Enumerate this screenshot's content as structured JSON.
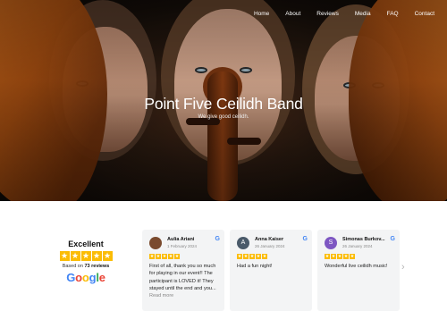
{
  "nav": {
    "items": [
      "Home",
      "About",
      "Reviews",
      "Media",
      "FAQ",
      "Contact"
    ]
  },
  "hero": {
    "title": "Point Five Ceilidh Band",
    "subtitle": "We give good ceilidh."
  },
  "summary": {
    "rating_word": "Excellent",
    "based_prefix": "Based on",
    "review_count": "73 reviews",
    "google_letters": [
      "G",
      "o",
      "o",
      "g",
      "l",
      "e"
    ],
    "stars": 5
  },
  "reviews": [
    {
      "name": "Aulia Ariani",
      "date": "1 February 2024",
      "avatar_initial": "",
      "avatar_color": "#7a4a2e",
      "text": "First of all, thank you so much for playing in our event!! The participant is LOVED it! They stayed until the end and you...",
      "read_more": "Read more"
    },
    {
      "name": "Anna Kaiser",
      "date": "26 January 2024",
      "avatar_initial": "A",
      "avatar_color": "#4a5a6a",
      "text": "Had a fun night!",
      "read_more": ""
    },
    {
      "name": "Simonas Burkov...",
      "date": "26 January 2024",
      "avatar_initial": "S",
      "avatar_color": "#7e57c2",
      "text": "Wonderful live ceilidh music!",
      "read_more": ""
    }
  ],
  "icons": {
    "next": "chevron-right-icon",
    "google": "google-g-icon",
    "star": "star-icon"
  },
  "colors": {
    "star": "#fbbc04",
    "card_bg": "#f3f4f5"
  }
}
